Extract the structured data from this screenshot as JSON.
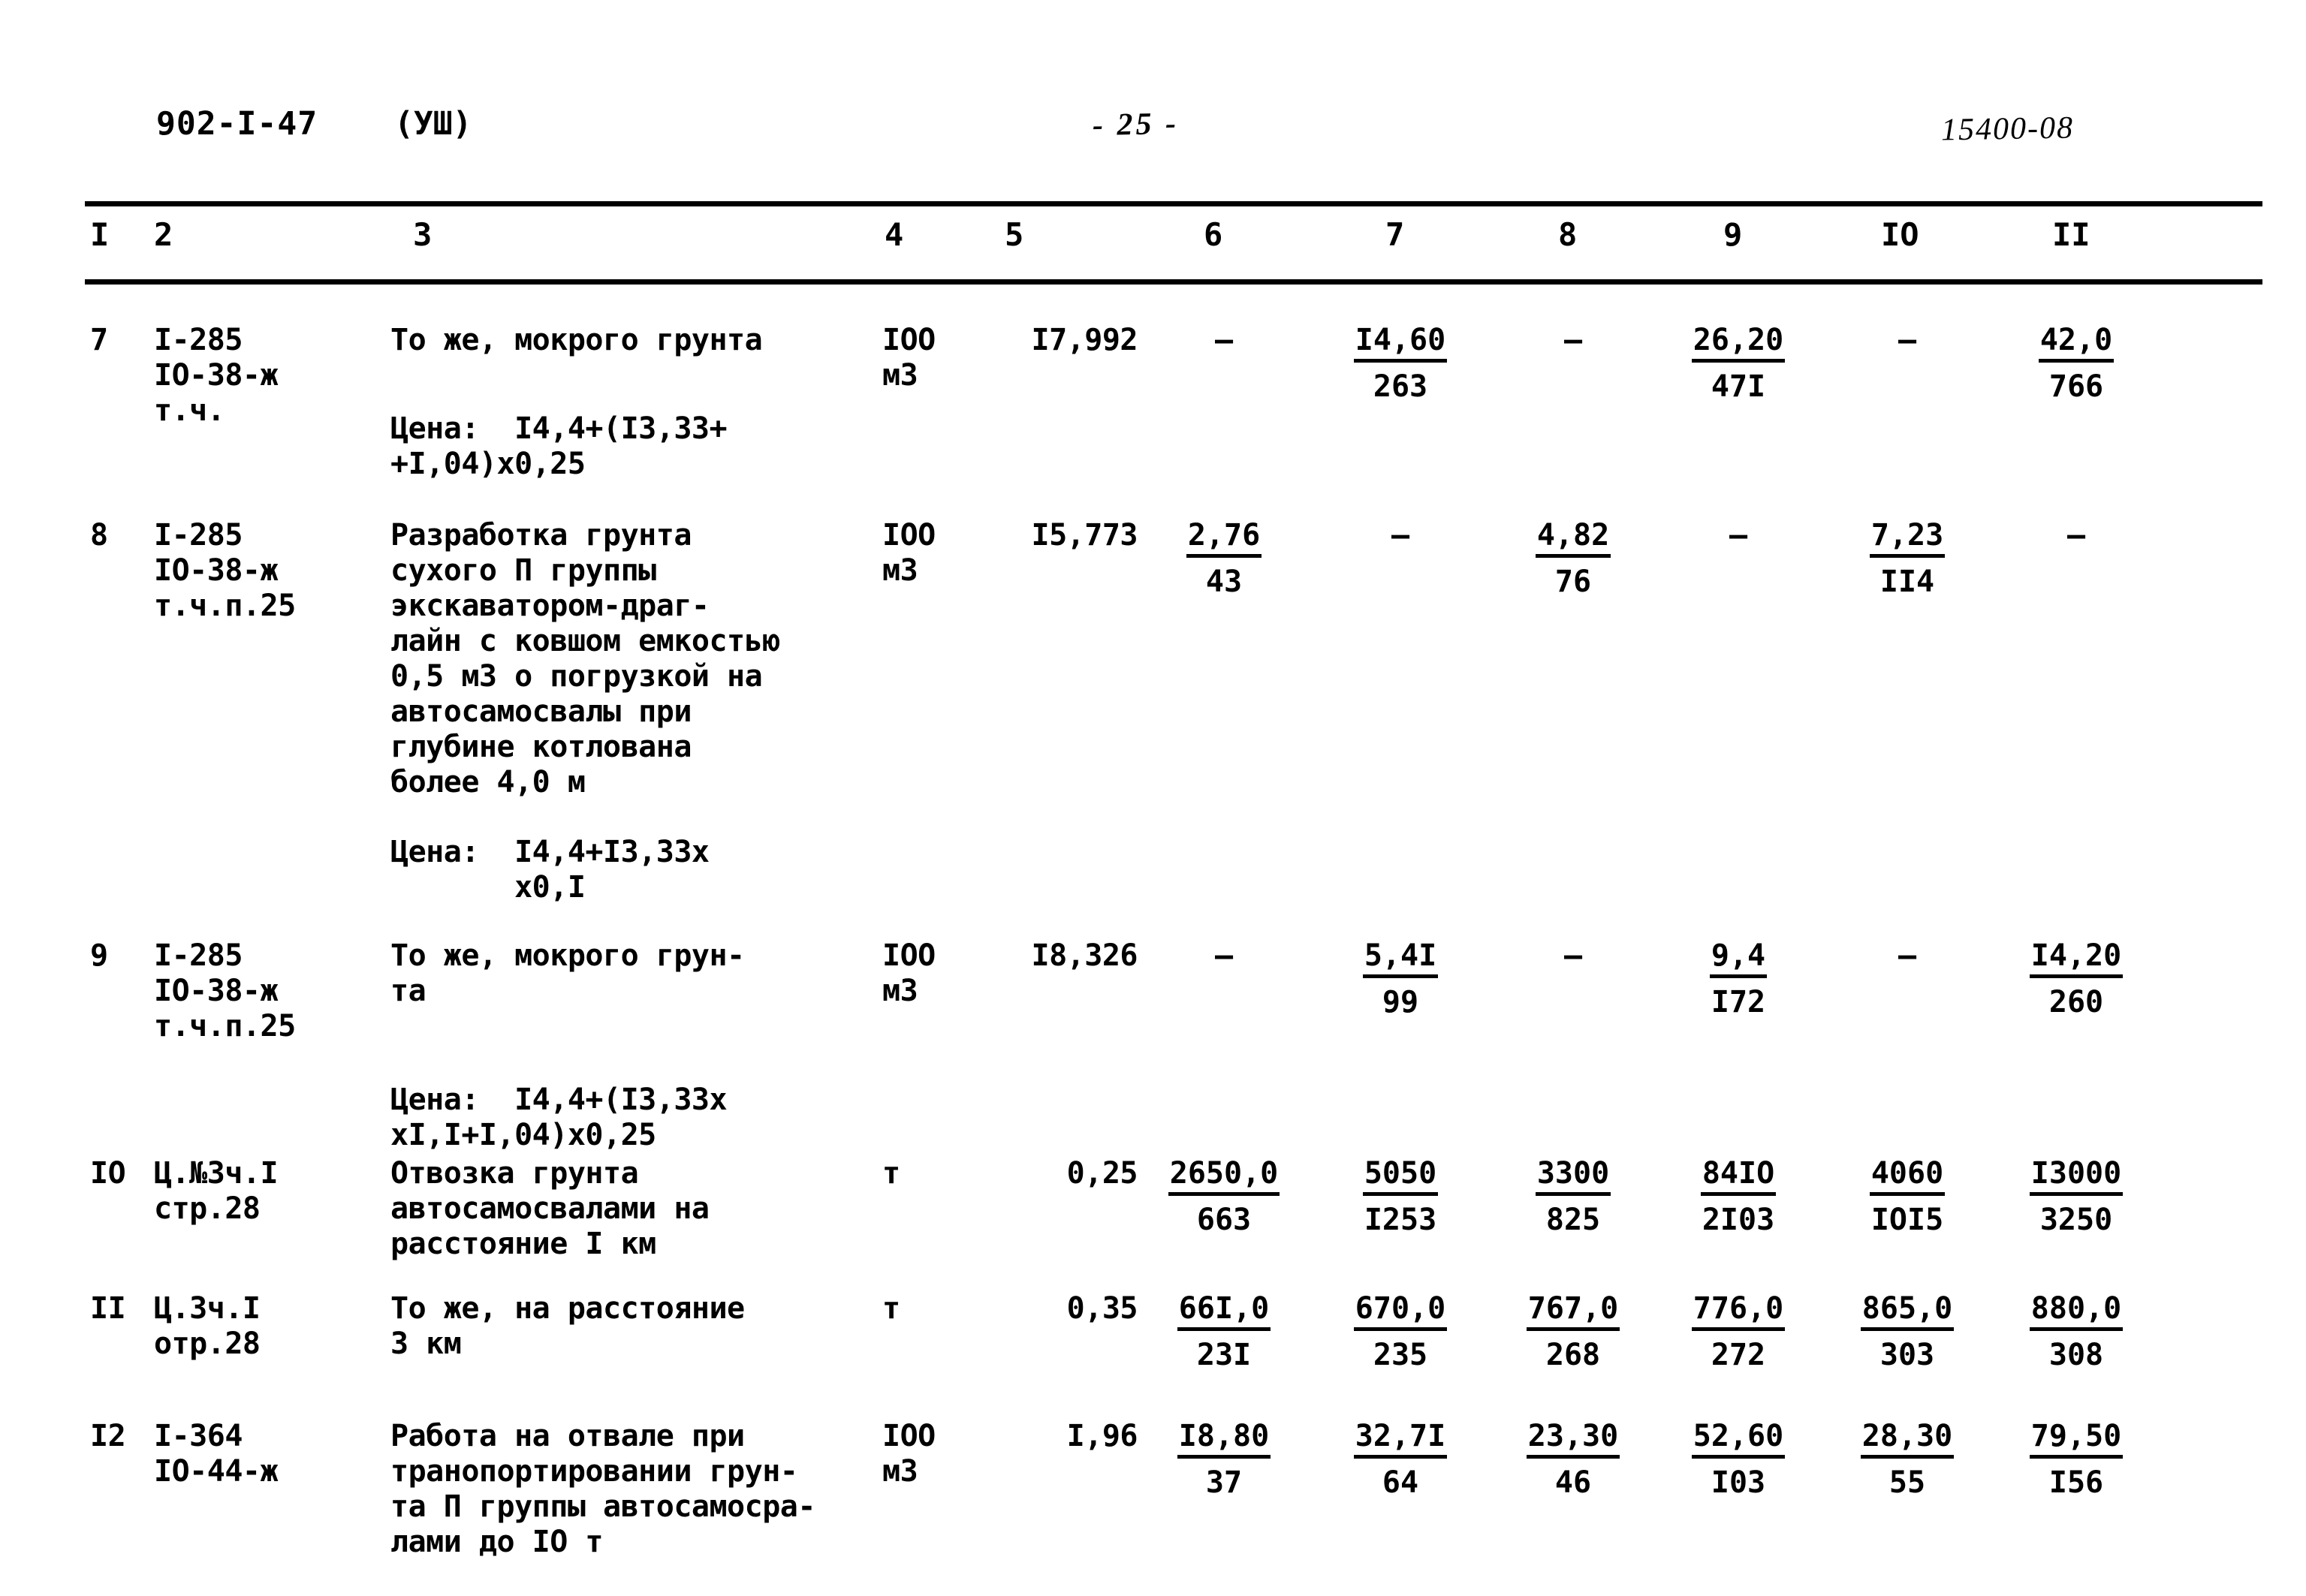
{
  "header": {
    "doc_code": "902-I-47",
    "doc_variant": "(УШ)",
    "page_number": "- 25 -",
    "sheet_code": "15400-08"
  },
  "table": {
    "column_numbers": [
      "I",
      "2",
      "3",
      "4",
      "5",
      "6",
      "7",
      "8",
      "9",
      "IO",
      "II"
    ],
    "rows": [
      {
        "no": "7",
        "code": "I-285\nIO-38-ж\nт.ч.",
        "desc": "То же, мокрого грунта",
        "price": "Цена:  I4,4+(I3,33+\n+I,04)х0,25",
        "unit": "IOO\nм3",
        "qty": "I7,992",
        "c6_num": "–",
        "c6_den": "",
        "c7_num": "I4,60",
        "c7_den": "263",
        "c8_num": "–",
        "c8_den": "",
        "c9_num": "26,20",
        "c9_den": "47I",
        "c10_num": "–",
        "c10_den": "",
        "c11_num": "42,0",
        "c11_den": "766"
      },
      {
        "no": "8",
        "code": "I-285\nIO-38-ж\nт.ч.п.25",
        "desc": "Разработка грунта\nсухого П группы\nэкскаватором-драг-\nлайн с ковшом емкостью\n0,5 м3 о погрузкой на\nавтосамосвалы при\nглубине котлована\nболее 4,0 м",
        "price": "Цена:  I4,4+I3,33х\n       х0,I",
        "unit": "IOO\nм3",
        "qty": "I5,773",
        "c6_num": "2,76",
        "c6_den": "43",
        "c7_num": "–",
        "c7_den": "",
        "c8_num": "4,82",
        "c8_den": "76",
        "c9_num": "–",
        "c9_den": "",
        "c10_num": "7,23",
        "c10_den": "II4",
        "c11_num": "–",
        "c11_den": ""
      },
      {
        "no": "9",
        "code": "I-285\nIO-38-ж\nт.ч.п.25",
        "desc": "То же, мокрого грун-\nта",
        "price": "Цена:  I4,4+(I3,33х\nхI,I+I,04)х0,25",
        "unit": "IOO\nм3",
        "qty": "I8,326",
        "c6_num": "–",
        "c6_den": "",
        "c7_num": "5,4I",
        "c7_den": "99",
        "c8_num": "–",
        "c8_den": "",
        "c9_num": "9,4",
        "c9_den": "I72",
        "c10_num": "–",
        "c10_den": "",
        "c11_num": "I4,20",
        "c11_den": "260"
      },
      {
        "no": "IO",
        "code": "Ц.№3ч.I\nстр.28",
        "desc": "Отвозка грунта\nавтосамосвалами на\nрасстояние I км",
        "price": "",
        "unit": "т",
        "qty": "0,25",
        "c6_num": "2650,0",
        "c6_den": "663",
        "c7_num": "5050",
        "c7_den": "I253",
        "c8_num": "3300",
        "c8_den": "825",
        "c9_num": "84IO",
        "c9_den": "2I03",
        "c10_num": "4060",
        "c10_den": "IOI5",
        "c11_num": "I3000",
        "c11_den": "3250"
      },
      {
        "no": "II",
        "code": "Ц.3ч.I\nотр.28",
        "desc": "То же, на расстояние\n3 км",
        "price": "",
        "unit": "т",
        "qty": "0,35",
        "c6_num": "66I,0",
        "c6_den": "23I",
        "c7_num": "670,0",
        "c7_den": "235",
        "c8_num": "767,0",
        "c8_den": "268",
        "c9_num": "776,0",
        "c9_den": "272",
        "c10_num": "865,0",
        "c10_den": "303",
        "c11_num": "880,0",
        "c11_den": "308"
      },
      {
        "no": "I2",
        "code": "I-364\nIO-44-ж",
        "desc": "Работа на отвале при\nтранопортировании грун-\nта П группы автосамосра-\nлами до IO т",
        "price": "",
        "unit": "IOO\nм3",
        "qty": "I,96",
        "c6_num": "I8,80",
        "c6_den": "37",
        "c7_num": "32,7I",
        "c7_den": "64",
        "c8_num": "23,30",
        "c8_den": "46",
        "c9_num": "52,60",
        "c9_den": "I03",
        "c10_num": "28,30",
        "c10_den": "55",
        "c11_num": "79,50",
        "c11_den": "I56"
      }
    ]
  }
}
